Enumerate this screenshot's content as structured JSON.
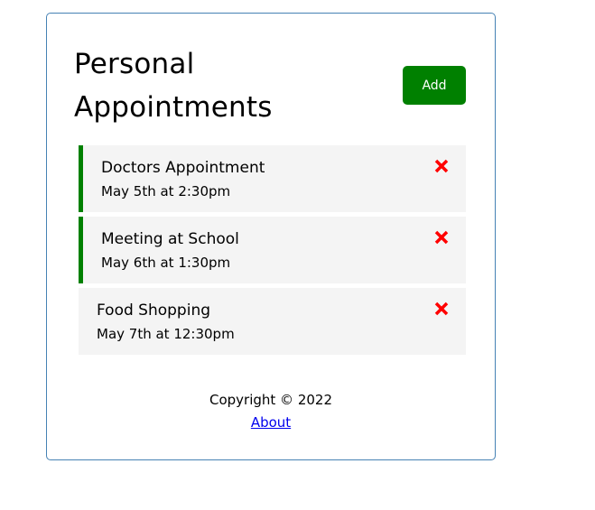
{
  "header": {
    "title": "Personal Appointments",
    "add_label": "Add"
  },
  "tasks": [
    {
      "text": "Doctors Appointment",
      "day": "May 5th at 2:30pm",
      "reminder": true
    },
    {
      "text": "Meeting at School",
      "day": "May 6th at 1:30pm",
      "reminder": true
    },
    {
      "text": "Food Shopping",
      "day": "May 7th at 12:30pm",
      "reminder": false
    }
  ],
  "footer": {
    "copyright": "Copyright © 2022",
    "about_label": "About"
  },
  "colors": {
    "accent": "#008000",
    "delete": "#ff0000",
    "task_background": "#f4f4f4",
    "border": "#4682b4"
  },
  "icons": {
    "delete": "times-icon"
  }
}
